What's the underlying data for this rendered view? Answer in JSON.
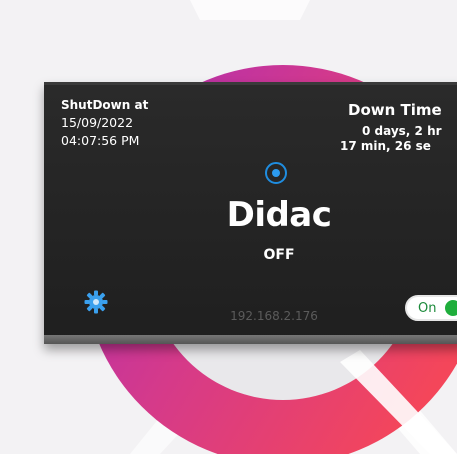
{
  "colors": {
    "ring_left": "#b433b7",
    "ring_right": "#f0455b",
    "card_bg": "#232323",
    "status_blue": "#1f8de0",
    "toggle_green": "#1fae3c",
    "ip_text": "#5b5b5b"
  },
  "shutdown": {
    "label": "ShutDown at",
    "date": "15/09/2022",
    "time": "04:07:56 PM"
  },
  "downtime": {
    "title": "Down Time",
    "line1": "0 days, 2 hr",
    "line2": "17 min, 26 se"
  },
  "device": {
    "name": "Didac",
    "state": "OFF",
    "ip": "192.168.2.176"
  },
  "toggle": {
    "label": "On",
    "state": "on"
  },
  "icons": {
    "status": "status-dot-icon",
    "settings": "gear-icon"
  }
}
